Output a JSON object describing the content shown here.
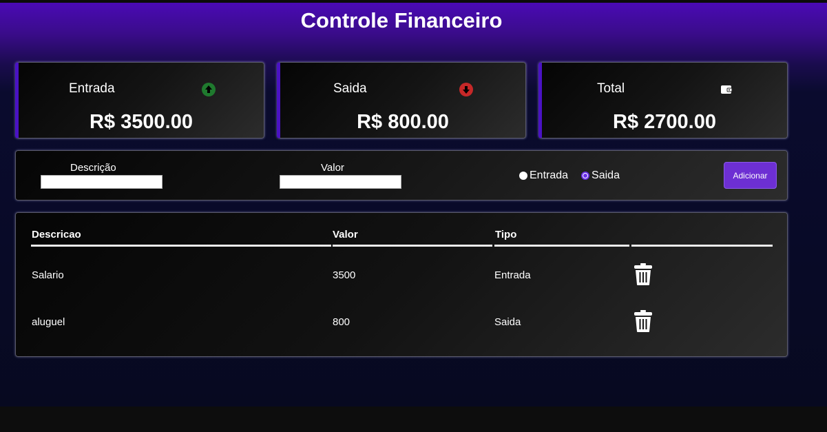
{
  "header": {
    "title": "Controle Financeiro"
  },
  "cards": [
    {
      "label": "Entrada",
      "amount": "R$ 3500.00",
      "icon": "arrow-up-circle-icon",
      "icon_color": "#1f7a2e"
    },
    {
      "label": "Saida",
      "amount": "R$ 800.00",
      "icon": "arrow-down-circle-icon",
      "icon_color": "#c62828"
    },
    {
      "label": "Total",
      "amount": "R$ 2700.00",
      "icon": "wallet-icon",
      "icon_color": "#ffffff"
    }
  ],
  "form": {
    "description_label": "Descrição",
    "description_value": "",
    "value_label": "Valor",
    "value_value": "",
    "type_options": [
      "Entrada",
      "Saida"
    ],
    "selected_type": "Saida",
    "add_button": "Adicionar"
  },
  "table": {
    "headers": [
      "Descricao",
      "Valor",
      "Tipo",
      ""
    ],
    "rows": [
      {
        "descricao": "Salario",
        "valor": "3500",
        "tipo": "Entrada",
        "action_icon": "trash-icon"
      },
      {
        "descricao": "aluguel",
        "valor": "800",
        "tipo": "Saida",
        "action_icon": "trash-icon"
      }
    ]
  },
  "colors": {
    "accent": "#6d2fd3",
    "header_gradient_top": "#4a0ab5",
    "background": "#070920"
  }
}
